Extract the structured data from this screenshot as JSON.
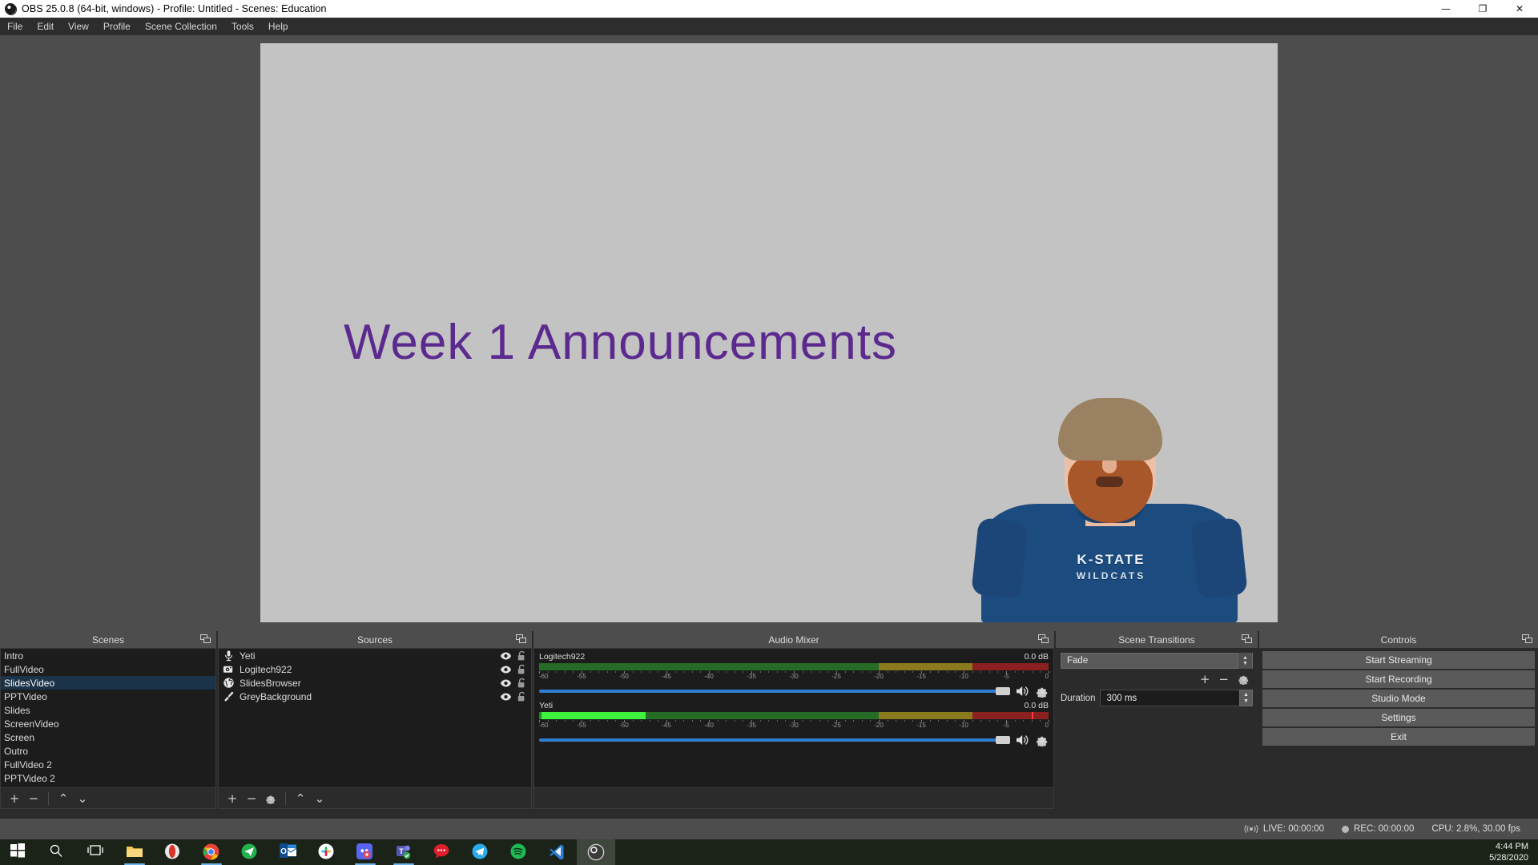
{
  "window": {
    "title": "OBS 25.0.8 (64-bit, windows) - Profile: Untitled - Scenes: Education",
    "logo": "obs-logo",
    "minimize": "—",
    "maximize": "❐",
    "close": "✕"
  },
  "menubar": [
    "File",
    "Edit",
    "View",
    "Profile",
    "Scene Collection",
    "Tools",
    "Help"
  ],
  "preview": {
    "slide_title": "Week 1 Announcements",
    "slide_title_color": "#5c2a8e",
    "background_color": "#c3c3c3",
    "webcam_shirt_line1": "K-STATE",
    "webcam_shirt_line2": "WILDCATS"
  },
  "scenes": {
    "title": "Scenes",
    "items": [
      {
        "label": "Intro",
        "selected": false
      },
      {
        "label": "FullVideo",
        "selected": false
      },
      {
        "label": "SlidesVideo",
        "selected": true
      },
      {
        "label": "PPTVideo",
        "selected": false
      },
      {
        "label": "Slides",
        "selected": false
      },
      {
        "label": "ScreenVideo",
        "selected": false
      },
      {
        "label": "Screen",
        "selected": false
      },
      {
        "label": "Outro",
        "selected": false
      },
      {
        "label": "FullVideo 2",
        "selected": false
      },
      {
        "label": "PPTVideo 2",
        "selected": false
      }
    ],
    "toolbar": {
      "add": "+",
      "remove": "−",
      "up": "⌃",
      "down": "⌄"
    }
  },
  "sources": {
    "title": "Sources",
    "items": [
      {
        "label": "Yeti",
        "icon": "microphone-icon",
        "visible": true,
        "locked": false
      },
      {
        "label": "Logitech922",
        "icon": "camera-icon",
        "visible": true,
        "locked": false
      },
      {
        "label": "SlidesBrowser",
        "icon": "globe-icon",
        "visible": true,
        "locked": false
      },
      {
        "label": "GreyBackground",
        "icon": "brush-icon",
        "visible": true,
        "locked": false
      }
    ],
    "toolbar": {
      "add": "+",
      "remove": "−",
      "properties": "gear-icon",
      "up": "⌃",
      "down": "⌄"
    }
  },
  "mixer": {
    "title": "Audio Mixer",
    "tick_labels": [
      "-60",
      "-55",
      "-50",
      "-45",
      "-40",
      "-35",
      "-30",
      "-25",
      "-20",
      "-15",
      "-10",
      "-5",
      "0"
    ],
    "tracks": [
      {
        "name": "Logitech922",
        "db": "0.0 dB",
        "level_db": -60,
        "peak_db": -60,
        "volume_pct": 100,
        "muted": false
      },
      {
        "name": "Yeti",
        "db": "0.0 dB",
        "level_db": -47.5,
        "peak_db": -2,
        "volume_pct": 100,
        "muted": false
      }
    ]
  },
  "transitions": {
    "title": "Scene Transitions",
    "selected": "Fade",
    "add": "+",
    "remove": "−",
    "properties": "gear-icon",
    "duration_label": "Duration",
    "duration_value": "300 ms"
  },
  "controls": {
    "title": "Controls",
    "buttons": [
      "Start Streaming",
      "Start Recording",
      "Studio Mode",
      "Settings",
      "Exit"
    ]
  },
  "statusbar": {
    "live_label": "LIVE: 00:00:00",
    "rec_label": "REC: 00:00:00",
    "cpu_label": "CPU: 2.8%, 30.00 fps"
  },
  "taskbar": {
    "items": [
      {
        "name": "start-button",
        "icon": "windows-logo"
      },
      {
        "name": "search",
        "icon": "search-icon"
      },
      {
        "name": "task-view",
        "icon": "task-view-icon"
      },
      {
        "name": "file-explorer",
        "icon": "folder-icon",
        "running": true
      },
      {
        "name": "opera",
        "icon": "opera-icon"
      },
      {
        "name": "chrome",
        "icon": "chrome-icon",
        "running": true
      },
      {
        "name": "telegram-green",
        "icon": "paper-plane-icon"
      },
      {
        "name": "outlook",
        "icon": "outlook-icon"
      },
      {
        "name": "slack",
        "icon": "slack-icon"
      },
      {
        "name": "discord",
        "icon": "discord-icon",
        "running": true
      },
      {
        "name": "microsoft-teams",
        "icon": "teams-icon",
        "running": true
      },
      {
        "name": "chat",
        "icon": "chat-bubble-icon"
      },
      {
        "name": "telegram",
        "icon": "telegram-icon"
      },
      {
        "name": "spotify",
        "icon": "spotify-icon"
      },
      {
        "name": "visual-studio-code",
        "icon": "vscode-icon"
      },
      {
        "name": "obs-studio",
        "icon": "obs-icon",
        "active": true
      }
    ],
    "time": "4:44 PM",
    "date": "5/28/2020"
  }
}
